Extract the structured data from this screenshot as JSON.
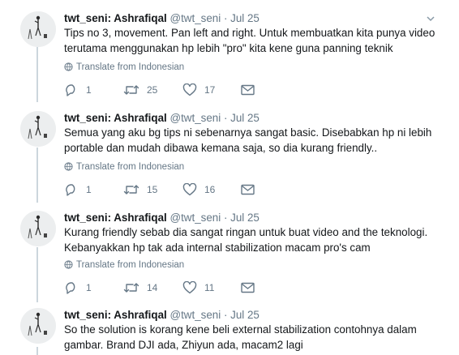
{
  "tweets": [
    {
      "name": "twt_seni: Ashrafiqal",
      "handle": "@twt_seni",
      "separator": "·",
      "time": "Jul 25",
      "line1": "Tips no 3, movement. Pan left and right. Untuk membuatkan kita punya video",
      "line2": "terutama menggunakan hp lebih \"pro\" kita kene guna panning teknik",
      "translate": "Translate from Indonesian",
      "replies": "1",
      "retweets": "25",
      "likes": "17"
    },
    {
      "name": "twt_seni: Ashrafiqal",
      "handle": "@twt_seni",
      "separator": "·",
      "time": "Jul 25",
      "line1": "Semua yang aku bg tips ni sebenarnya sangat basic. Disebabkan hp ni lebih",
      "line2": "portable dan mudah dibawa kemana saja, so dia kurang friendly..",
      "translate": "Translate from Indonesian",
      "replies": "1",
      "retweets": "15",
      "likes": "16"
    },
    {
      "name": "twt_seni: Ashrafiqal",
      "handle": "@twt_seni",
      "separator": "·",
      "time": "Jul 25",
      "line1": "Kurang friendly sebab dia sangat ringan untuk buat video and the teknologi.",
      "line2": "Kebanyakkan hp tak ada internal stabilization macam pro's cam",
      "translate": "Translate from Indonesian",
      "replies": "1",
      "retweets": "14",
      "likes": "11"
    },
    {
      "name": "twt_seni: Ashrafiqal",
      "handle": "@twt_seni",
      "separator": "·",
      "time": "Jul 25",
      "line1": "So the solution is korang kene beli external stabilization contohnya dalam",
      "line2": "gambar. Brand DJI ada, Zhiyun ada, macam2 lagi"
    }
  ],
  "colors": {
    "text": "#14171a",
    "secondary": "#657786",
    "thread_line": "#ccd6dd"
  },
  "icons": [
    "caret-down-icon",
    "globe-icon",
    "reply-icon",
    "retweet-icon",
    "like-icon",
    "dm-icon",
    "avatar"
  ]
}
